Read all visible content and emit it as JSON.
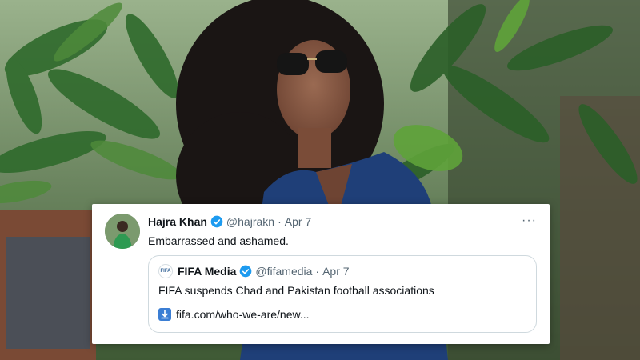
{
  "tweet": {
    "author_name": "Hajra Khan",
    "author_handle": "@hajrakn",
    "separator": "·",
    "date": "Apr 7",
    "more_label": "···",
    "text": "Embarrassed and ashamed.",
    "avatar_icon": "profile-photo-icon",
    "verified_icon": "verified-badge-icon",
    "verified_color": "#1d9bf0"
  },
  "quoted_tweet": {
    "author_name": "FIFA Media",
    "author_handle": "@fifamedia",
    "separator": "·",
    "date": "Apr 7",
    "avatar_text": "FIFA",
    "text": "FIFA suspends Chad and Pakistan football associations",
    "link_text": "fifa.com/who-we-are/new...",
    "link_icon": "download-arrow-icon",
    "link_icon_color": "#3b7ed4"
  }
}
